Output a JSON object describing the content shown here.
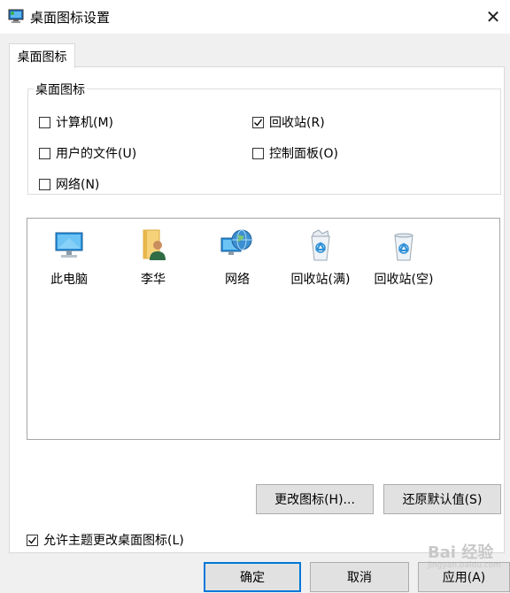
{
  "window": {
    "title": "桌面图标设置",
    "app_icon": "monitor-settings-icon",
    "close_icon": "close-icon",
    "close_glyph": "✕"
  },
  "tabs": [
    {
      "label": "桌面图标",
      "active": true
    }
  ],
  "desktop_icons_group": {
    "legend": "桌面图标",
    "checkboxes": [
      {
        "label": "计算机(M)",
        "checked": false
      },
      {
        "label": "回收站(R)",
        "checked": true
      },
      {
        "label": "用户的文件(U)",
        "checked": false
      },
      {
        "label": "控制面板(O)",
        "checked": false
      },
      {
        "label": "网络(N)",
        "checked": false
      }
    ]
  },
  "icon_list": [
    {
      "label": "此电脑",
      "icon": "this-pc-icon"
    },
    {
      "label": "李华",
      "icon": "user-folder-icon"
    },
    {
      "label": "网络",
      "icon": "network-globe-icon"
    },
    {
      "label": "回收站(满)",
      "icon": "recycle-bin-full-icon"
    },
    {
      "label": "回收站(空)",
      "icon": "recycle-bin-empty-icon"
    }
  ],
  "buttons": {
    "change_icon": "更改图标(H)...",
    "restore_default": "还原默认值(S)",
    "ok": "确定",
    "cancel": "取消",
    "apply": "应用(A)"
  },
  "allow_themes": {
    "label": "允许主题更改桌面图标(L)",
    "checked": true
  },
  "watermark": {
    "text": "Bai 经验",
    "sub": "jingyan.baidu.com"
  },
  "colors": {
    "focus_border": "#0078d7",
    "panel_bg": "#f0f0f0"
  }
}
